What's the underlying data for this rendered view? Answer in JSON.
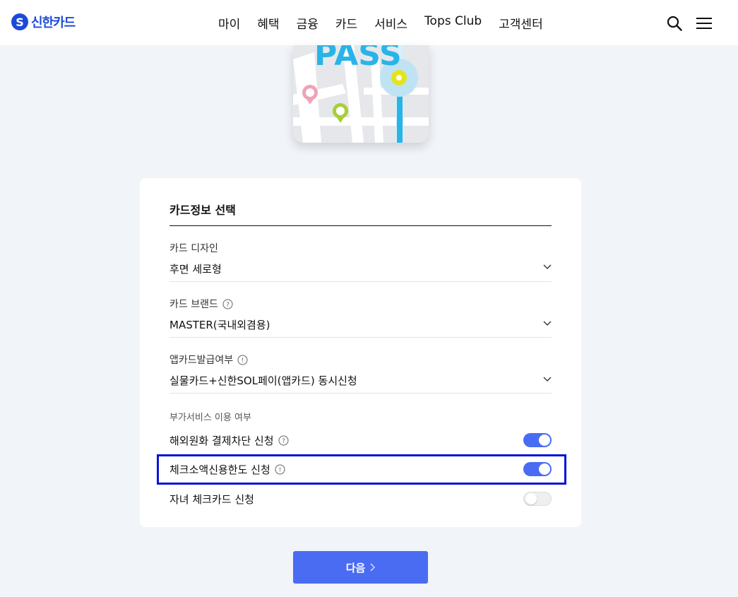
{
  "header": {
    "logo_mark": "S",
    "logo_text": "신한카드",
    "nav": [
      "마이",
      "혜택",
      "금융",
      "카드",
      "서비스",
      "Tops Club",
      "고객센터"
    ]
  },
  "card_image": {
    "text": "PASS"
  },
  "form": {
    "title": "카드정보 선택",
    "fields": [
      {
        "label": "카드 디자인",
        "value": "후면 세로형",
        "info": "none"
      },
      {
        "label": "카드 브랜드",
        "value": "MASTER(국내외겸용)",
        "info": "question"
      },
      {
        "label": "앱카드발급여부",
        "value": "실물카드+신한SOL페이(앱카드) 동시신청",
        "info": "exclamation"
      }
    ],
    "section_label": "부가서비스 이용 여부",
    "options": [
      {
        "label": "해외원화 결제차단 신청",
        "info": "question",
        "enabled": true
      },
      {
        "label": "체크소액신용한도 신청",
        "info": "exclamation",
        "enabled": true
      },
      {
        "label": "자녀 체크카드 신청",
        "info": "none",
        "enabled": false
      }
    ]
  },
  "next_button": {
    "label": "다음"
  },
  "colors": {
    "brand": "#1c4ad8",
    "accent": "#4a6cf2",
    "highlight": "#0a14d6",
    "background": "#f1f4f9"
  }
}
